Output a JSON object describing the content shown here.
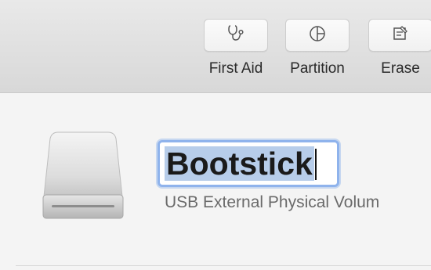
{
  "toolbar": {
    "buttons": [
      {
        "label": "First Aid",
        "icon": "stethoscope-icon"
      },
      {
        "label": "Partition",
        "icon": "pie-chart-icon"
      },
      {
        "label": "Erase",
        "icon": "eraser-icon"
      }
    ]
  },
  "volume": {
    "name": "Bootstick",
    "subtitle": "USB External Physical Volum"
  },
  "colors": {
    "toolbar_bg": "#e0e0e0",
    "content_bg": "#f4f4f4",
    "selection": "#b7cdea",
    "focus_ring": "#8fb3ec"
  }
}
